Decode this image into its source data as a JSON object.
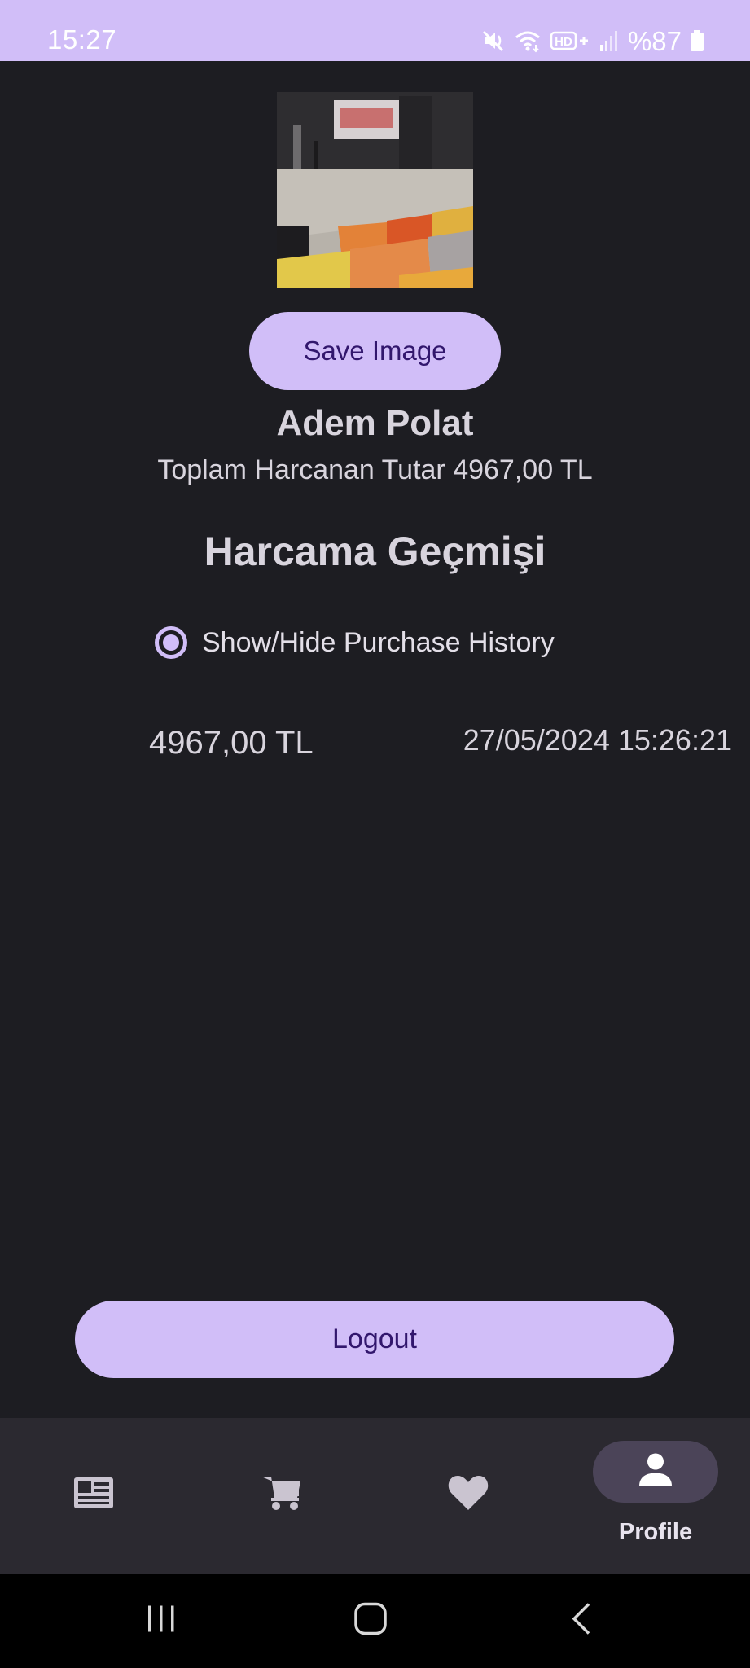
{
  "status_bar": {
    "time": "15:27",
    "battery": "%87",
    "icons": [
      "mute-icon",
      "wifi-icon",
      "hd-plus-icon",
      "signal-icon",
      "battery-icon"
    ]
  },
  "profile": {
    "save_image_label": "Save Image",
    "name": "Adem Polat",
    "total_spent": "Toplam Harcanan Tutar 4967,00 TL"
  },
  "history": {
    "title": "Harcama Geçmişi",
    "toggle_label": "Show/Hide Purchase History",
    "toggle_selected": true,
    "purchases": [
      {
        "amount": "4967,00 TL",
        "date": "27/05/2024 15:26:21"
      }
    ]
  },
  "logout_label": "Logout",
  "bottom_nav": {
    "items": [
      {
        "icon": "news-icon",
        "label": ""
      },
      {
        "icon": "cart-icon",
        "label": ""
      },
      {
        "icon": "heart-icon",
        "label": ""
      },
      {
        "icon": "person-icon",
        "label": "Profile",
        "selected": true
      }
    ]
  },
  "colors": {
    "accent": "#d1bef8",
    "background": "#1d1d22",
    "nav_background": "#2b2930",
    "button_text": "#32176d"
  }
}
